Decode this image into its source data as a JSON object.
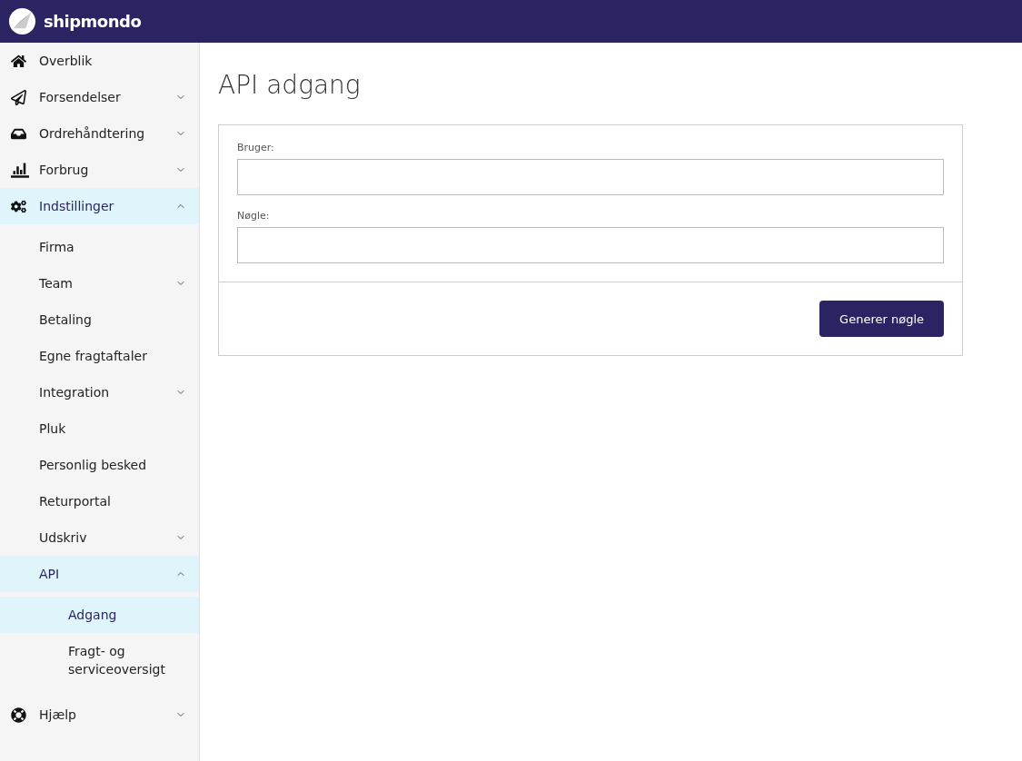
{
  "brand": {
    "name": "shipmondo"
  },
  "sidebar": {
    "items": [
      {
        "label": "Overblik",
        "selected": false
      },
      {
        "label": "Forsendelser",
        "selected": false,
        "expanded": false
      },
      {
        "label": "Ordrehåndtering",
        "selected": false,
        "expanded": false
      },
      {
        "label": "Forbrug",
        "selected": false,
        "expanded": false
      },
      {
        "label": "Indstillinger",
        "selected": true,
        "expanded": true,
        "children": [
          {
            "label": "Firma",
            "selected": false
          },
          {
            "label": "Team",
            "selected": false,
            "expanded": false
          },
          {
            "label": "Betaling",
            "selected": false
          },
          {
            "label": "Egne fragtaftaler",
            "selected": false
          },
          {
            "label": "Integration",
            "selected": false,
            "expanded": false
          },
          {
            "label": "Pluk",
            "selected": false
          },
          {
            "label": "Personlig besked",
            "selected": false
          },
          {
            "label": "Returportal",
            "selected": false
          },
          {
            "label": "Udskriv",
            "selected": false,
            "expanded": false
          },
          {
            "label": "API",
            "selected": true,
            "expanded": true,
            "children": [
              {
                "label": "Adgang",
                "selected": true
              },
              {
                "label": "Fragt- og serviceoversigt",
                "selected": false
              }
            ]
          }
        ]
      },
      {
        "label": "Hjælp",
        "selected": false,
        "expanded": false
      }
    ]
  },
  "page": {
    "title": "API adgang"
  },
  "form": {
    "fields": [
      {
        "label": "Bruger:"
      },
      {
        "label": "Nøgle:"
      }
    ],
    "button": "Generer nøgle"
  }
}
